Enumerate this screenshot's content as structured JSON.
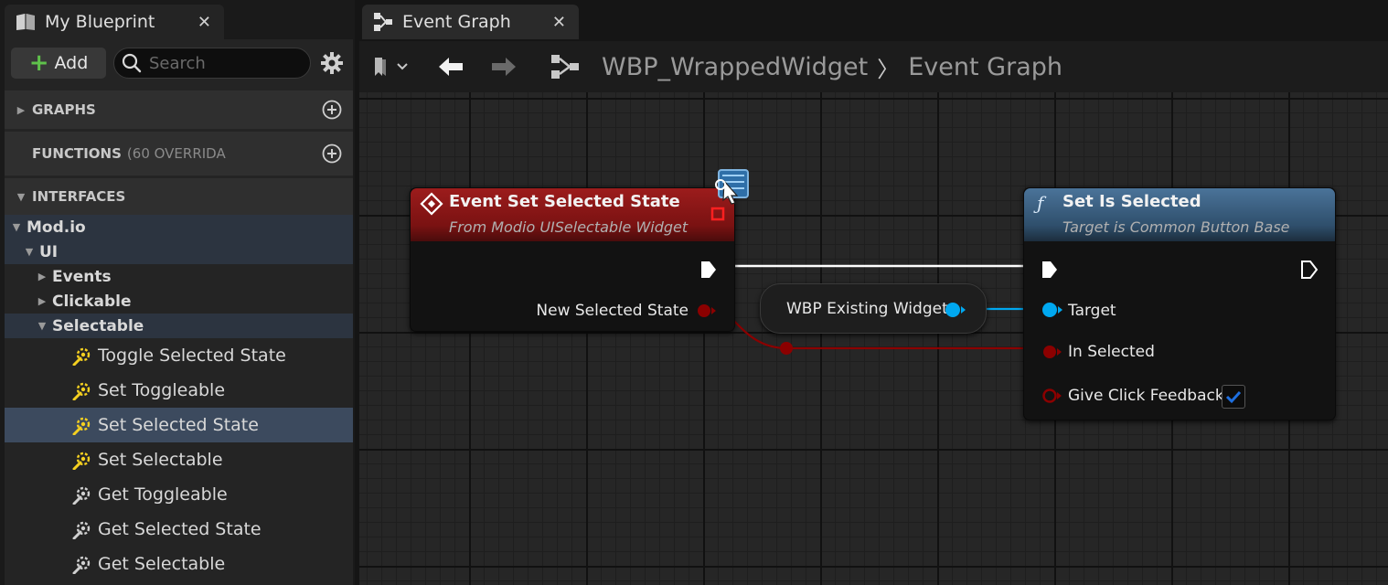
{
  "left_panel": {
    "tab_title": "My Blueprint",
    "close_glyph": "✕",
    "add_label": "Add",
    "search_placeholder": "Search",
    "sections": {
      "graphs": "GRAPHS",
      "functions": "FUNCTIONS",
      "functions_sub": "(60 OVERRIDA",
      "interfaces": "INTERFACES"
    },
    "tree": {
      "modio": "Mod.io",
      "ui": "UI",
      "events": "Events",
      "clickable": "Clickable",
      "selectable": "Selectable"
    },
    "functions_list": [
      {
        "label": "Toggle Selected State",
        "icon": "event-function-icon"
      },
      {
        "label": "Set Toggleable",
        "icon": "event-function-icon"
      },
      {
        "label": "Set Selected State",
        "icon": "event-function-icon",
        "selected": true
      },
      {
        "label": "Set Selectable",
        "icon": "event-function-icon"
      },
      {
        "label": "Get Toggleable",
        "icon": "pure-function-icon"
      },
      {
        "label": "Get Selected State",
        "icon": "pure-function-icon"
      },
      {
        "label": "Get Selectable",
        "icon": "pure-function-icon"
      }
    ]
  },
  "right_panel": {
    "tab_title": "Event Graph",
    "close_glyph": "✕",
    "breadcrumb": {
      "blueprint": "WBP_WrappedWidget",
      "separator": "〉",
      "graph": "Event Graph"
    }
  },
  "graph": {
    "event_node": {
      "title": "Event Set Selected State",
      "subtitle": "From Modio UISelectable Widget",
      "pin_new_selected_state": "New Selected State"
    },
    "getter_node": {
      "label": "WBP Existing Widget"
    },
    "function_node": {
      "title": "Set Is Selected",
      "subtitle": "Target is Common Button Base",
      "function_glyph": "ƒ",
      "pin_target": "Target",
      "pin_in_selected": "In Selected",
      "pin_give_click_feedback": "Give Click Feedback",
      "give_click_feedback_checked": true
    }
  },
  "colors": {
    "event_header": "#8c1616",
    "function_header": "#3a5f80",
    "exec_wire": "#ffffff",
    "bool_pin": "#8b0000",
    "object_pin": "#00a8f0",
    "selection": "#3c4a5e",
    "add_plus": "#5fc24b",
    "checkbox": "#1e6fe0"
  }
}
